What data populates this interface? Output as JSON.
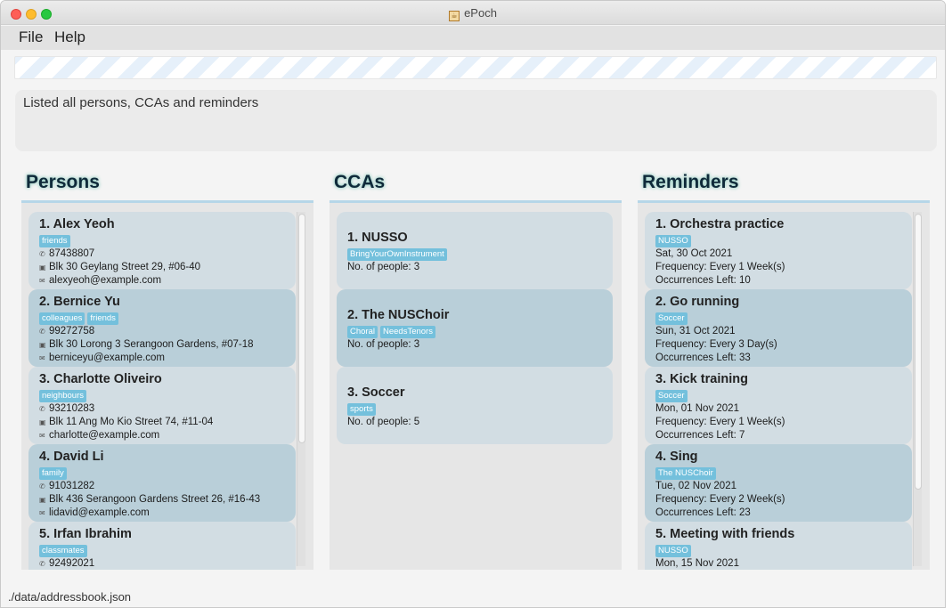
{
  "window": {
    "title": "ePoch"
  },
  "menu": {
    "file": "File",
    "help": "Help"
  },
  "command_box": {
    "placeholder": ""
  },
  "result": {
    "message": "Listed all persons, CCAs and reminders"
  },
  "persons": {
    "title": "Persons",
    "items": [
      {
        "title": "1.  Alex Yeoh",
        "tags": [
          "friends"
        ],
        "phone": "87438807",
        "address": "Blk 30 Geylang Street 29, #06-40",
        "email": "alexyeoh@example.com"
      },
      {
        "title": "2.  Bernice Yu",
        "tags": [
          "colleagues",
          "friends"
        ],
        "phone": "99272758",
        "address": "Blk 30 Lorong 3 Serangoon Gardens, #07-18",
        "email": "berniceyu@example.com"
      },
      {
        "title": "3.  Charlotte Oliveiro",
        "tags": [
          "neighbours"
        ],
        "phone": "93210283",
        "address": "Blk 11 Ang Mo Kio Street 74, #11-04",
        "email": "charlotte@example.com"
      },
      {
        "title": "4.  David Li",
        "tags": [
          "family"
        ],
        "phone": "91031282",
        "address": "Blk 436 Serangoon Gardens Street 26, #16-43",
        "email": "lidavid@example.com"
      },
      {
        "title": "5.  Irfan Ibrahim",
        "tags": [
          "classmates"
        ],
        "phone": "92492021",
        "address": "",
        "email": ""
      }
    ]
  },
  "ccas": {
    "title": "CCAs",
    "items": [
      {
        "title": "1.  NUSSO",
        "tags": [
          "BringYourOwnInstrument"
        ],
        "people": "No. of people: 3"
      },
      {
        "title": "2.  The NUSChoir",
        "tags": [
          "Choral",
          "NeedsTenors"
        ],
        "people": "No. of people: 3"
      },
      {
        "title": "3.  Soccer",
        "tags": [
          "sports"
        ],
        "people": "No. of people: 5"
      }
    ]
  },
  "reminders": {
    "title": "Reminders",
    "items": [
      {
        "title": "1.  Orchestra practice",
        "tags": [
          "NUSSO"
        ],
        "date": "Sat, 30 Oct 2021",
        "frequency": "Frequency: Every 1 Week(s)",
        "occurrences": "Occurrences Left: 10"
      },
      {
        "title": "2.  Go running",
        "tags": [
          "Soccer"
        ],
        "date": "Sun, 31 Oct 2021",
        "frequency": "Frequency: Every 3 Day(s)",
        "occurrences": "Occurrences Left: 33"
      },
      {
        "title": "3.  Kick training",
        "tags": [
          "Soccer"
        ],
        "date": "Mon, 01 Nov 2021",
        "frequency": "Frequency: Every 1 Week(s)",
        "occurrences": "Occurrences Left: 7"
      },
      {
        "title": "4.  Sing",
        "tags": [
          "The NUSChoir"
        ],
        "date": "Tue, 02 Nov 2021",
        "frequency": "Frequency: Every 2 Week(s)",
        "occurrences": "Occurrences Left: 23"
      },
      {
        "title": "5.  Meeting with friends",
        "tags": [
          "NUSSO"
        ],
        "date": "Mon, 15 Nov 2021",
        "frequency": "",
        "occurrences": ""
      }
    ]
  },
  "status_bar": {
    "path": "./data/addressbook.json"
  },
  "colors": {
    "tag_bg": "#74c0dc",
    "card_light": "#d2dde3",
    "card_dark": "#b9cfd9",
    "header_glow": "#9fd3c8"
  }
}
